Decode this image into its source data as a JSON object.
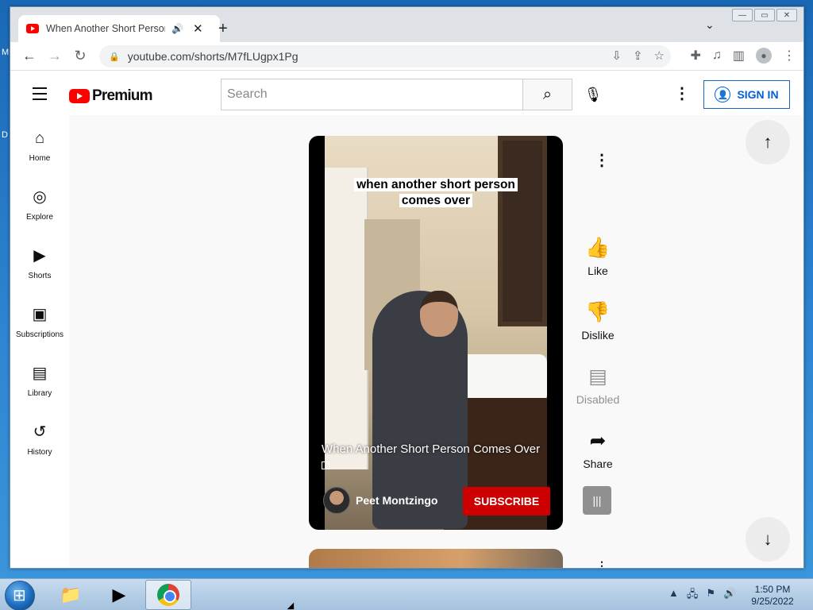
{
  "browser": {
    "tab_title": "When Another Short Person",
    "tab_audio_icon": "speaker-icon",
    "url": "youtube.com/shorts/M7fLUgpx1Pg"
  },
  "yt": {
    "logo_text": "Premium",
    "search_placeholder": "Search",
    "signin_label": "SIGN IN",
    "sidebar": [
      {
        "label": "Home",
        "icon": "⌂"
      },
      {
        "label": "Explore",
        "icon": "◎"
      },
      {
        "label": "Shorts",
        "icon": "▶"
      },
      {
        "label": "Subscriptions",
        "icon": "▣"
      },
      {
        "label": "Library",
        "icon": "▤"
      },
      {
        "label": "History",
        "icon": "↺"
      }
    ],
    "short": {
      "caption_line1": "when another short person",
      "caption_line2": "comes over",
      "title": "When Another Short Person Comes Over",
      "channel": "Peet Montzingo",
      "subscribe_label": "SUBSCRIBE"
    },
    "actions": {
      "like": "Like",
      "dislike": "Dislike",
      "comments": "Disabled",
      "share": "Share"
    }
  },
  "taskbar": {
    "time": "1:50 PM",
    "date": "9/25/2022"
  }
}
